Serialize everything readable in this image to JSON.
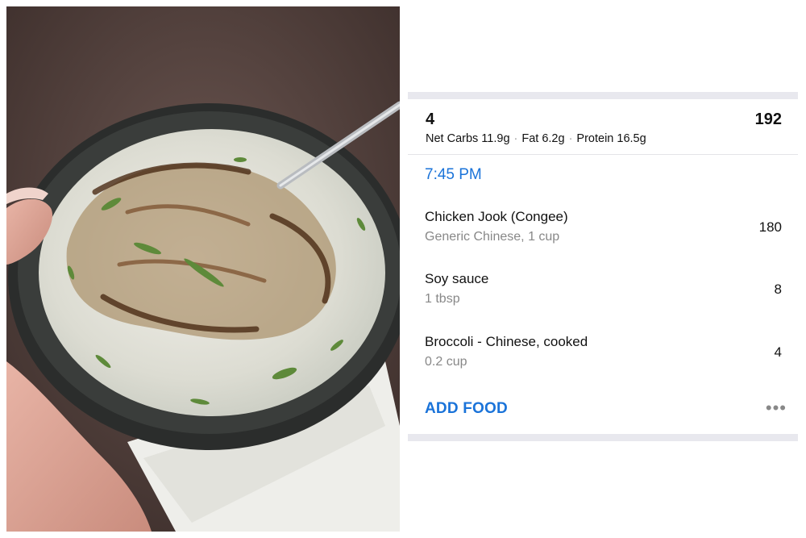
{
  "meal": {
    "number": "4",
    "total_calories": "192",
    "macros": {
      "net_carbs": "Net Carbs 11.9g",
      "fat": "Fat 6.2g",
      "protein": "Protein 16.5g"
    },
    "time": "7:45 PM"
  },
  "foods": [
    {
      "name": "Chicken Jook (Congee)",
      "description": "Generic Chinese, 1 cup",
      "calories": "180"
    },
    {
      "name": "Soy sauce",
      "description": "1 tbsp",
      "calories": "8"
    },
    {
      "name": "Broccoli - Chinese, cooked",
      "description": "0.2 cup",
      "calories": "4"
    }
  ],
  "actions": {
    "add_food": "ADD FOOD",
    "more_icon": "more-horizontal-icon"
  },
  "colors": {
    "accent_blue": "#1a73d9",
    "separator": "#e8e8ee"
  }
}
